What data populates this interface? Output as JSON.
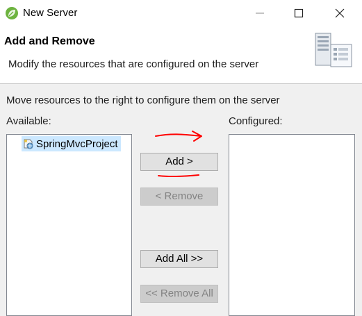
{
  "window": {
    "title": "New Server",
    "app_icon": "spring-leaf-icon",
    "controls": [
      "minimize-icon",
      "maximize-icon",
      "close-icon"
    ]
  },
  "header": {
    "title": "Add and Remove",
    "description": "Modify the resources that are configured on the server",
    "image": "server-icon"
  },
  "body": {
    "instructions": "Move resources to the right to configure them on the server",
    "available_label": "Available:",
    "configured_label": "Configured:",
    "available_items": [
      {
        "label": "SpringMvcProject",
        "icon": "web-project-icon",
        "selected": true
      }
    ],
    "configured_items": []
  },
  "buttons": {
    "add": "Add >",
    "remove": "< Remove",
    "add_all": "Add All >>",
    "remove_all": "<< Remove All"
  },
  "colors": {
    "annotation": "#ff0000",
    "selection": "#cce8ff",
    "disabled_button": "#cccccc"
  }
}
